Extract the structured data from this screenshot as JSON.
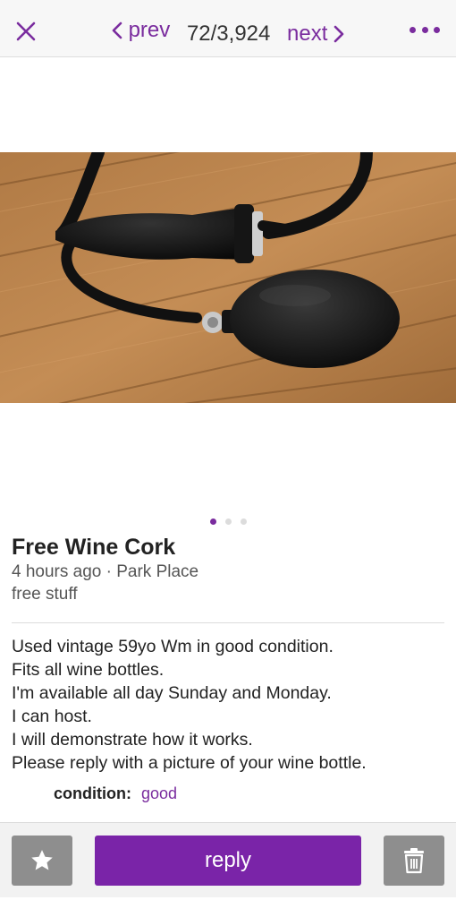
{
  "header": {
    "close_icon": "close-icon",
    "prev_label": "prev",
    "position": "72/3,924",
    "next_label": "next",
    "more_icon": "more-horizontal-icon"
  },
  "gallery": {
    "image_count": 3,
    "active_index": 0
  },
  "listing": {
    "title": "Free Wine Cork",
    "meta": "4 hours ago · Park Place",
    "category": "free stuff",
    "body_lines": [
      "Used vintage 59yo Wm in good condition.",
      "Fits all wine bottles.",
      "I'm available all day Sunday and Monday.",
      "I can host.",
      "I will demonstrate how it works.",
      "Please reply with a picture of your wine bottle."
    ],
    "condition_label": "condition:",
    "condition_value": "good"
  },
  "footer": {
    "favorite_icon": "star-icon",
    "reply_label": "reply",
    "delete_icon": "trash-icon"
  },
  "colors": {
    "accent": "#7a2c9e",
    "reply_button": "#7a24a8",
    "icon_button": "#8e8e8e"
  }
}
